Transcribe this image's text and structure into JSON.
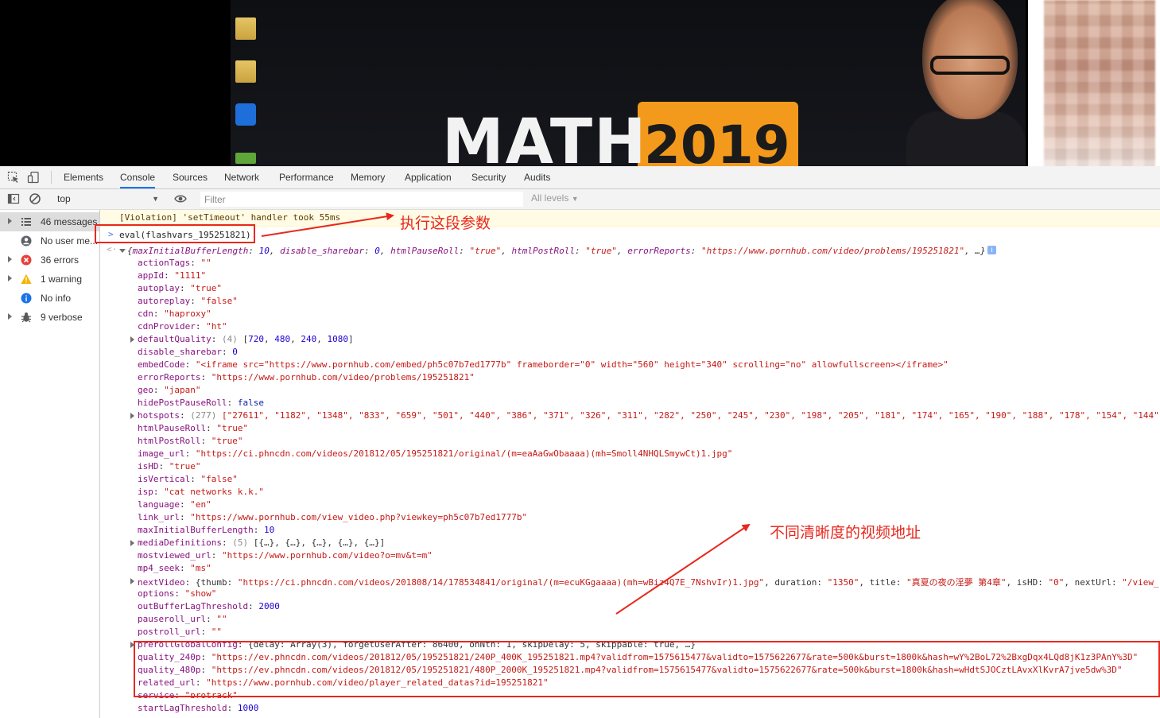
{
  "video": {
    "headline_word": "MATH",
    "headline_year": "2019",
    "desktop_labels": [
      "",
      "",
      "",
      ""
    ]
  },
  "devtools": {
    "tabs": [
      "Elements",
      "Console",
      "Sources",
      "Network",
      "Performance",
      "Memory",
      "Application",
      "Security",
      "Audits"
    ],
    "active_tab": "Console",
    "context": "top",
    "filter_placeholder": "Filter",
    "levels": "All levels"
  },
  "sidebar": {
    "items": [
      {
        "label": "46 messages",
        "icon": "list-icon",
        "expandable": true
      },
      {
        "label": "No user me...",
        "icon": "user-icon",
        "expandable": false
      },
      {
        "label": "36 errors",
        "icon": "error-icon",
        "expandable": true
      },
      {
        "label": "1 warning",
        "icon": "warning-icon",
        "expandable": true
      },
      {
        "label": "No info",
        "icon": "info-icon",
        "expandable": false
      },
      {
        "label": "9 verbose",
        "icon": "bug-icon",
        "expandable": true
      }
    ]
  },
  "console": {
    "violation": "[Violation] 'setTimeout' handler took 55ms",
    "command": "eval(flashvars_195251821)",
    "summary": {
      "open": "{",
      "p1k": "maxInitialBufferLength",
      "p1v": "10",
      "p2k": "disable_sharebar",
      "p2v": "0",
      "p3k": "htmlPauseRoll",
      "p3v": "\"true\"",
      "p4k": "htmlPostRoll",
      "p4v": "\"true\"",
      "p5k": "errorReports",
      "p5v": "\"https://www.pornhub.com/video/problems/195251821\"",
      "tail": ", …}"
    },
    "props": {
      "actionTags": {
        "k": "actionTags",
        "v": "\"\""
      },
      "appId": {
        "k": "appId",
        "v": "\"1111\""
      },
      "autoplay": {
        "k": "autoplay",
        "v": "\"true\""
      },
      "autoreplay": {
        "k": "autoreplay",
        "v": "\"false\""
      },
      "cdn": {
        "k": "cdn",
        "v": "\"haproxy\""
      },
      "cdnProvider": {
        "k": "cdnProvider",
        "v": "\"ht\""
      },
      "defaultQuality": {
        "k": "defaultQuality",
        "count": "(4)",
        "open": "[",
        "v1": "720",
        "v2": "480",
        "v3": "240",
        "v4": "1080",
        "close": "]"
      },
      "disable_sharebar": {
        "k": "disable_sharebar",
        "v": "0"
      },
      "embedCode": {
        "k": "embedCode",
        "v": "\"<iframe src=\"https://www.pornhub.com/embed/ph5c07b7ed1777b\" frameborder=\"0\" width=\"560\" height=\"340\" scrolling=\"no\" allowfullscreen></iframe>\""
      },
      "errorReports": {
        "k": "errorReports",
        "v": "\"https://www.pornhub.com/video/problems/195251821\""
      },
      "geo": {
        "k": "geo",
        "v": "\"japan\""
      },
      "hidePostPauseRoll": {
        "k": "hidePostPauseRoll",
        "v": "false"
      },
      "hotspots": {
        "k": "hotspots",
        "count": "(277)",
        "v": "[\"27611\", \"1182\", \"1348\", \"833\", \"659\", \"501\", \"440\", \"386\", \"371\", \"326\", \"311\", \"282\", \"250\", \"245\", \"230\", \"198\", \"205\", \"181\", \"174\", \"165\", \"190\", \"188\", \"178\", \"154\", \"144\","
      },
      "htmlPauseRoll": {
        "k": "htmlPauseRoll",
        "v": "\"true\""
      },
      "htmlPostRoll": {
        "k": "htmlPostRoll",
        "v": "\"true\""
      },
      "image_url": {
        "k": "image_url",
        "v": "\"https://ci.phncdn.com/videos/201812/05/195251821/original/(m=eaAaGwObaaaa)(mh=Smoll4NHQLSmywCt)1.jpg\""
      },
      "isHD": {
        "k": "isHD",
        "v": "\"true\""
      },
      "isVertical": {
        "k": "isVertical",
        "v": "\"false\""
      },
      "isp": {
        "k": "isp",
        "v": "\"cat networks k.k.\""
      },
      "language": {
        "k": "language",
        "v": "\"en\""
      },
      "link_url": {
        "k": "link_url",
        "v": "\"https://www.pornhub.com/view_video.php?viewkey=ph5c07b7ed1777b\""
      },
      "maxInitialBufferLength": {
        "k": "maxInitialBufferLength",
        "v": "10"
      },
      "mediaDefinitions": {
        "k": "mediaDefinitions",
        "count": "(5)",
        "v": "[{…}, {…}, {…}, {…}, {…}]"
      },
      "mostviewed_url": {
        "k": "mostviewed_url",
        "v": "\"https://www.pornhub.com/video?o=mv&t=m\""
      },
      "mp4_seek": {
        "k": "mp4_seek",
        "v": "\"ms\""
      },
      "nextVideo": {
        "k": "nextVideo",
        "v1k": "thumb",
        "v1": "\"https://ci.phncdn.com/videos/201808/14/178534841/original/(m=ecuKGgaaaa)(mh=wBiz4Q7E_7NshvIr)1.jpg\"",
        "v2k": "duration",
        "v2": "\"1350\"",
        "v3k": "title",
        "v3": "\"真夏の夜の淫夢 第4章\"",
        "v4k": "isHD",
        "v4": "\"0\"",
        "v5k": "nextUrl",
        "v5": "\"/view_"
      },
      "options": {
        "k": "options",
        "v": "\"show\""
      },
      "outBufferLagThreshold": {
        "k": "outBufferLagThreshold",
        "v": "2000"
      },
      "pauseroll_url": {
        "k": "pauseroll_url",
        "v": "\"\""
      },
      "postroll_url": {
        "k": "postroll_url",
        "v": "\"\""
      },
      "prerollGlobalConfig": {
        "k": "prerollGlobalConfig",
        "v": "{delay: Array(3), forgetUserAfter: 86400, onNth: 1, skipDelay: 5, skippable: true, …}"
      },
      "quality_240p": {
        "k": "quality_240p",
        "v": "\"https://ev.phncdn.com/videos/201812/05/195251821/240P_400K_195251821.mp4?validfrom=1575615477&validto=1575622677&rate=500k&burst=1800k&hash=wY%2BoL72%2BxgDqx4LQd8jK1z3PAnY%3D\""
      },
      "quality_480p": {
        "k": "quality_480p",
        "v": "\"https://ev.phncdn.com/videos/201812/05/195251821/480P_2000K_195251821.mp4?validfrom=1575615477&validto=1575622677&rate=500k&burst=1800k&hash=wHdtSJOCztLAvxXlKvrA7jve5dw%3D\""
      },
      "related_url": {
        "k": "related_url",
        "v": "\"https://www.pornhub.com/video/player_related_datas?id=195251821\""
      },
      "service": {
        "k": "service",
        "v": "\"protrack\""
      },
      "startLagThreshold": {
        "k": "startLagThreshold",
        "v": "1000"
      }
    }
  },
  "annotations": {
    "execute": "执行这段参数",
    "urls": "不同清晰度的视频地址",
    "color": "#e8281e"
  }
}
